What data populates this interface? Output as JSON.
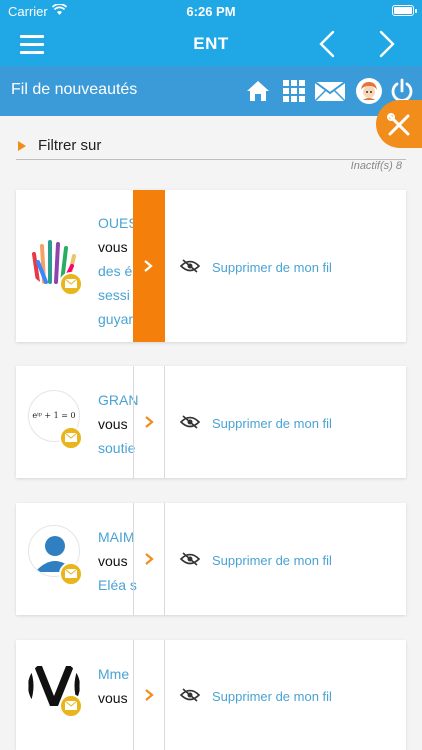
{
  "status_bar": {
    "carrier": "Carrier",
    "time": "6:26 PM"
  },
  "nav": {
    "title": "ENT",
    "menu_icon": "hamburger-icon",
    "prev_icon": "chevron-left-icon",
    "next_icon": "chevron-right-icon"
  },
  "subheader": {
    "title": "Fil de nouveautés"
  },
  "filter": {
    "label": "Filtrer sur",
    "inactive": "Inactif(s) 8"
  },
  "cards": [
    {
      "lines": [
        "OUES",
        "vous",
        "des é",
        "sessi",
        "guyar"
      ],
      "remove": "Supprimer de mon fil",
      "thumb": "hands"
    },
    {
      "lines": [
        "GRAN",
        "vous",
        "soutie"
      ],
      "remove": "Supprimer de mon fil",
      "thumb": "formula",
      "formula": "eⁱᵖ + 1 = 0"
    },
    {
      "lines": [
        "MAIM",
        "vous",
        "Eléa s"
      ],
      "remove": "Supprimer de mon fil",
      "thumb": "person"
    },
    {
      "lines": [
        "Mme",
        "vous"
      ],
      "remove": "Supprimer de mon fil",
      "thumb": "logo"
    }
  ],
  "colors": {
    "primary": "#1fa7e6",
    "secondary": "#3a9bd8",
    "accent": "#f28c1b",
    "link": "#4aa3d4",
    "badge": "#e8b51c"
  }
}
